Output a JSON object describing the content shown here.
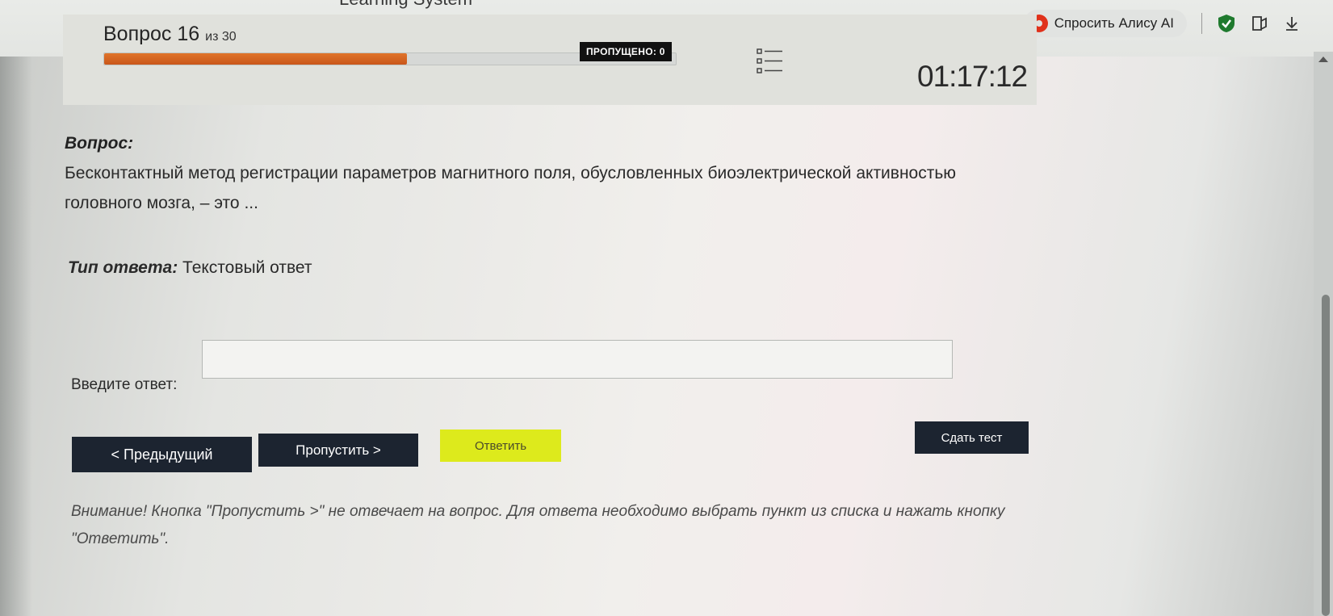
{
  "browser": {
    "site_title": "Learning System",
    "toolbar_dots": "•••",
    "alice_button": "Спросить Алису AI"
  },
  "quiz": {
    "question_word": "Вопрос",
    "question_number": "16",
    "question_total": "из 30",
    "progress_fraction": 0.53,
    "skipped_label": "ПРОПУЩЕНО: 0",
    "timer": "01:17:12"
  },
  "question": {
    "label": "Вопрос:",
    "text": "Бесконтактный метод регистрации параметров магнитного поля, обусловленных биоэлектрической активностью головного мозга, – это ..."
  },
  "answer_type": {
    "label": "Тип ответа:",
    "value": "Текстовый ответ"
  },
  "answer": {
    "label": "Введите ответ:",
    "value": ""
  },
  "buttons": {
    "prev": "< Предыдущий",
    "skip": "Пропустить >",
    "answer": "Ответить",
    "finish": "Сдать тест"
  },
  "warning": "Внимание! Кнопка \"Пропустить >\" не отвечает на вопрос. Для ответа необходимо выбрать пункт из списка и нажать кнопку \"Ответить\"."
}
